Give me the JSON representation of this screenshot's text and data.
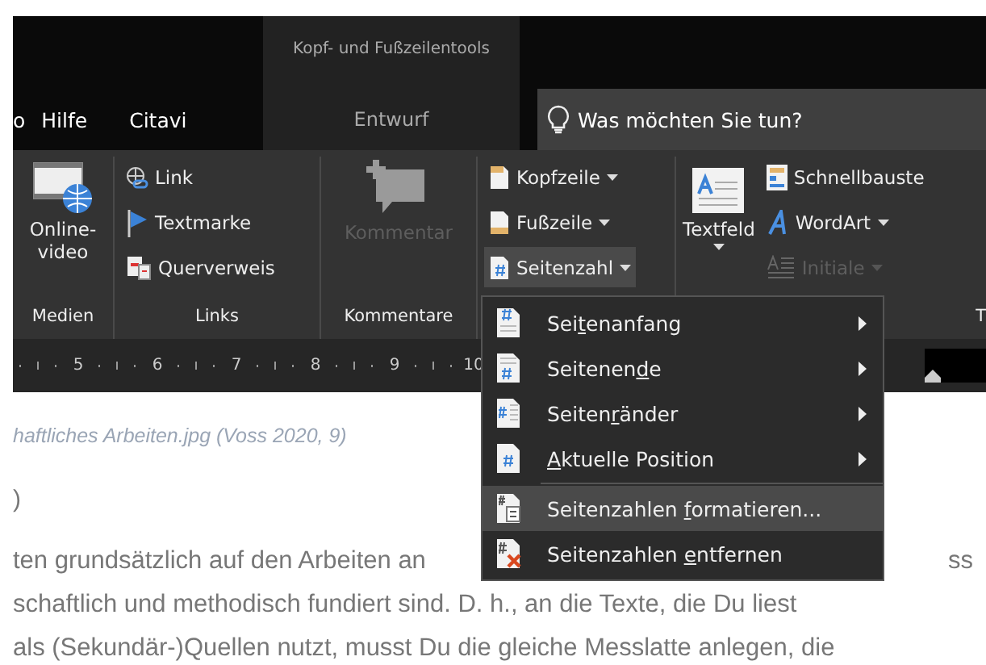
{
  "title_bar": {
    "context_title": "Kopf- und Fußzeilentools",
    "context_tabs": [
      {
        "label": "Entwurf",
        "selected": false
      }
    ]
  },
  "tabs": [
    {
      "label": "o",
      "selected": false
    },
    {
      "label": "Hilfe",
      "selected": false
    },
    {
      "label": "Citavi",
      "selected": false
    }
  ],
  "search": {
    "placeholder": "Was möchten Sie tun?"
  },
  "ribbon": {
    "groups": [
      {
        "label": "Medien",
        "kind": "media",
        "items": [
          {
            "label": "Online-video",
            "disabled": false
          }
        ]
      },
      {
        "label": "Links",
        "kind": "links",
        "items": [
          {
            "label": "Link",
            "disabled": false
          },
          {
            "label": "Textmarke",
            "disabled": false
          },
          {
            "label": "Querverweis",
            "disabled": false
          }
        ]
      },
      {
        "label": "Kommentare",
        "kind": "comments",
        "items": [
          {
            "label": "Kommentar",
            "disabled": true
          }
        ]
      },
      {
        "kind": "headers",
        "items": [
          {
            "label": "Kopfzeile",
            "disabled": false,
            "pressed": false
          },
          {
            "label": "Fußzeile",
            "disabled": false,
            "pressed": false
          },
          {
            "label": "Seitenzahl",
            "disabled": false,
            "pressed": true
          }
        ]
      },
      {
        "label": "T",
        "kind": "text",
        "items": [
          {
            "label": "Textfeld",
            "disabled": false
          },
          {
            "label": "Schnellbauste",
            "disabled": false
          },
          {
            "label": "WordArt",
            "disabled": false
          },
          {
            "label": "Initiale",
            "disabled": true
          }
        ]
      }
    ]
  },
  "ruler": {
    "numbers": [
      "5",
      "6",
      "7",
      "8",
      "9",
      "10"
    ]
  },
  "document": {
    "caption": "haftliches Arbeiten.jpg (Voss 2020, 9)",
    "heading": ")",
    "lines": [
      {
        "text": "ten grundsätzlich auf den Arbeiten an",
        "tail": "ss"
      },
      {
        "text": "schaftlich und methodisch fundiert sind. D. h., an die Texte, die Du liest"
      },
      {
        "text": "als (Sekundär-)Quellen nutzt, musst Du die gleiche Messlatte anlegen, die"
      }
    ]
  },
  "menu": {
    "items": [
      {
        "before": "Sei",
        "key": "t",
        "after": "enanfang",
        "kind": "top",
        "submenu": true,
        "selected": false
      },
      {
        "before": "Seitenen",
        "key": "d",
        "after": "e",
        "kind": "bottom",
        "submenu": true,
        "selected": false
      },
      {
        "before": "Seiten",
        "key": "r",
        "after": "änder",
        "kind": "margins",
        "submenu": true,
        "selected": false
      },
      {
        "key": "A",
        "after": "ktuelle Position",
        "kind": "current",
        "submenu": true,
        "selected": false
      },
      {
        "before": "Seitenzahlen ",
        "key": "f",
        "after": "ormatieren...",
        "kind": "format",
        "submenu": false,
        "selected": true
      },
      {
        "before": "Seitenzahlen ",
        "key": "e",
        "after": "ntfernen",
        "kind": "remove",
        "submenu": false,
        "selected": false
      }
    ]
  }
}
